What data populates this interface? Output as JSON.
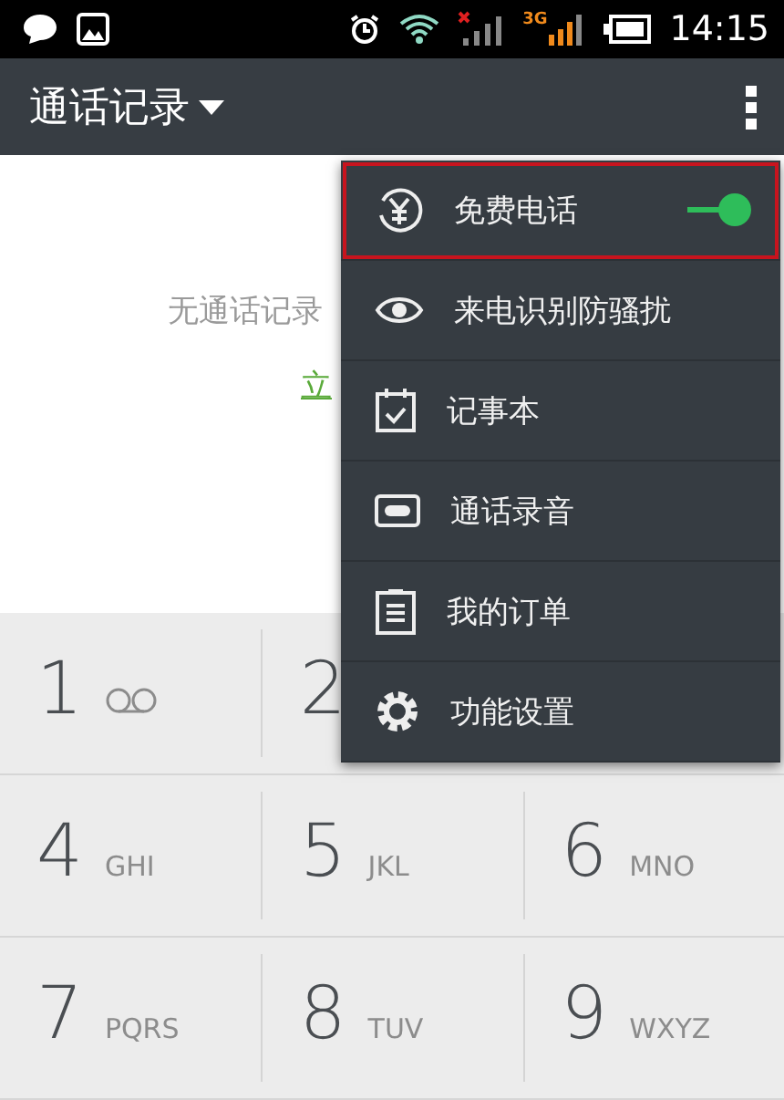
{
  "status_bar": {
    "network": "3G",
    "time": "14:15"
  },
  "app_bar": {
    "title": "通话记录"
  },
  "empty_state": {
    "message": "无通话记录",
    "link": "立"
  },
  "keypad": [
    [
      {
        "digit": "1",
        "kind": "voicemail"
      },
      {
        "digit": "2",
        "kind": "plain"
      }
    ],
    [
      {
        "digit": "4",
        "letters": "GHI",
        "kind": "plain"
      },
      {
        "digit": "5",
        "letters": "JKL",
        "kind": "plain"
      },
      {
        "digit": "6",
        "letters": "MNO",
        "kind": "plain"
      }
    ],
    [
      {
        "digit": "7",
        "letters": "PQRS",
        "kind": "plain"
      },
      {
        "digit": "8",
        "letters": "TUV",
        "kind": "plain"
      },
      {
        "digit": "9",
        "letters": "WXYZ",
        "kind": "plain"
      }
    ]
  ],
  "menu": [
    {
      "label": "免费电话",
      "kind": "toggle",
      "on": true,
      "highlighted": true
    },
    {
      "label": "来电识别防骚扰",
      "kind": "plain",
      "highlighted": false
    },
    {
      "label": "记事本",
      "kind": "plain",
      "highlighted": false
    },
    {
      "label": "通话录音",
      "kind": "plain",
      "highlighted": false
    },
    {
      "label": "我的订单",
      "kind": "plain",
      "highlighted": false
    },
    {
      "label": "功能设置",
      "kind": "plain",
      "highlighted": false
    }
  ]
}
